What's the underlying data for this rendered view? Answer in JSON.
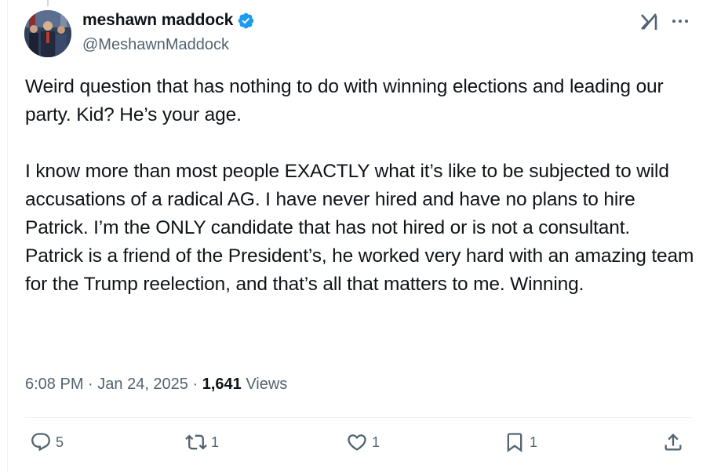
{
  "author": {
    "display_name": "meshawn maddock",
    "handle": "@MeshawnMaddock",
    "verified_icon": "verified-badge-icon",
    "accent_color": "#1d9bf0"
  },
  "tweet": {
    "text": "Weird question that has nothing to do with winning elections and leading our party. Kid? He’s your age.\n\nI know more than most people EXACTLY what it’s like to be subjected to wild accusations of a radical AG. I have never hired and have no plans to hire Patrick. I’m the ONLY candidate that has not hired or is not a consultant.\nPatrick is a friend of the President’s, he worked very hard with an amazing team for the Trump reelection, and that’s all that matters to me. Winning."
  },
  "meta": {
    "time": "6:08 PM",
    "separator": " · ",
    "date": "Jan 24, 2025",
    "views_count": "1,641",
    "views_label": " Views"
  },
  "actions": {
    "replies": "5",
    "reposts": "1",
    "likes": "1",
    "bookmarks": "1"
  },
  "icons": {
    "grok": "grok-icon",
    "more": "more-icon",
    "reply": "reply-icon",
    "repost": "repost-icon",
    "like": "heart-icon",
    "bookmark": "bookmark-icon",
    "share": "share-icon"
  },
  "colors": {
    "text_primary": "#0f1419",
    "text_secondary": "#536471",
    "divider": "#eff3f4"
  }
}
